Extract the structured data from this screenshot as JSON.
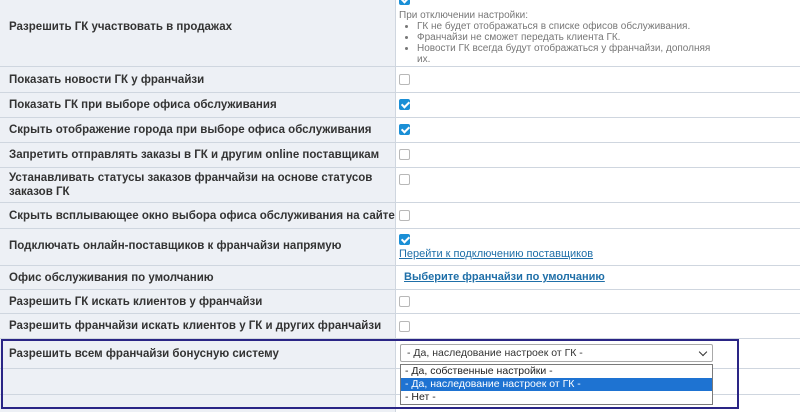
{
  "settings": [
    {
      "label": "Разрешить ГК участвовать в продажах",
      "checked": true,
      "note_title": "При отключении настройки:",
      "note_items": [
        "ГК не будет отображаться в списке офисов обслуживания.",
        "Франчайзи не сможет передать клиента ГК.",
        "Новости ГК всегда будут отображаться у франчайзи, дополняя их."
      ]
    },
    {
      "label": "Показать новости ГК у франчайзи",
      "checked": false
    },
    {
      "label": "Показать ГК при выборе офиса обслуживания",
      "checked": true
    },
    {
      "label": "Скрыть отображение города при выборе офиса обслуживания",
      "checked": true
    },
    {
      "label": "Запретить отправлять заказы в ГК и другим online поставщикам",
      "checked": false
    },
    {
      "label": "Устанавливать статусы заказов франчайзи на основе статусов заказов ГК",
      "checked": false
    },
    {
      "label": "Скрыть всплывающее окно выбора офиса обслуживания на сайте",
      "checked": false
    },
    {
      "label": "Подключать онлайн-поставщиков к франчайзи напрямую",
      "checked": true,
      "link": "Перейти к подключению поставщиков"
    },
    {
      "label": "Офис обслуживания по умолчанию",
      "link": "Выберите франчайзи по умолчанию"
    },
    {
      "label": "Разрешить ГК искать клиентов у франчайзи",
      "checked": false
    },
    {
      "label": "Разрешить франчайзи искать клиентов у ГК и других франчайзи",
      "checked": false
    },
    {
      "label": "Разрешить всем франчайзи бонусную систему"
    }
  ],
  "bonus_select": {
    "value": "- Да, наследование настроек от ГК -",
    "options": [
      "- Да, собственные настройки -",
      "- Да, наследование настроек от ГК -",
      "- Нет -"
    ],
    "highlighted_index": 1
  }
}
